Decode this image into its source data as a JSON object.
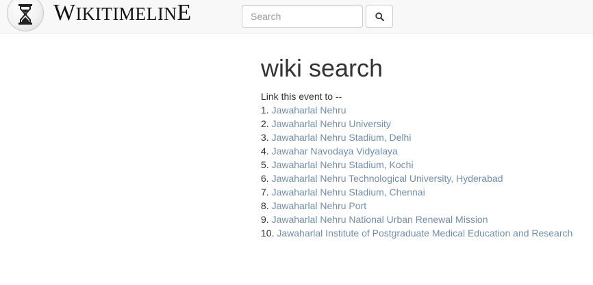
{
  "brand": {
    "name_parts": [
      "W",
      "IKITIMELIN",
      "E"
    ]
  },
  "search": {
    "placeholder": "Search",
    "value": ""
  },
  "page": {
    "title": "wiki search",
    "intro": "Link this event to --"
  },
  "results": [
    {
      "num": "1.",
      "label": "Jawaharlal Nehru"
    },
    {
      "num": "2.",
      "label": "Jawaharlal Nehru University"
    },
    {
      "num": "3.",
      "label": "Jawaharlal Nehru Stadium, Delhi"
    },
    {
      "num": "4.",
      "label": "Jawahar Navodaya Vidyalaya"
    },
    {
      "num": "5.",
      "label": "Jawaharlal Nehru Stadium, Kochi"
    },
    {
      "num": "6.",
      "label": "Jawaharlal Nehru Technological University, Hyderabad"
    },
    {
      "num": "7.",
      "label": "Jawaharlal Nehru Stadium, Chennai"
    },
    {
      "num": "8.",
      "label": "Jawaharlal Nehru Port"
    },
    {
      "num": "9.",
      "label": "Jawaharlal Nehru National Urban Renewal Mission"
    },
    {
      "num": "10.",
      "label": "Jawaharlal Institute of Postgraduate Medical Education and Research"
    }
  ],
  "icons": {
    "logo": "hourglass-icon",
    "search_button": "search-icon"
  },
  "colors": {
    "link": "#6f8faf",
    "navbar_bg": "#f8f8f8",
    "text": "#333333"
  }
}
